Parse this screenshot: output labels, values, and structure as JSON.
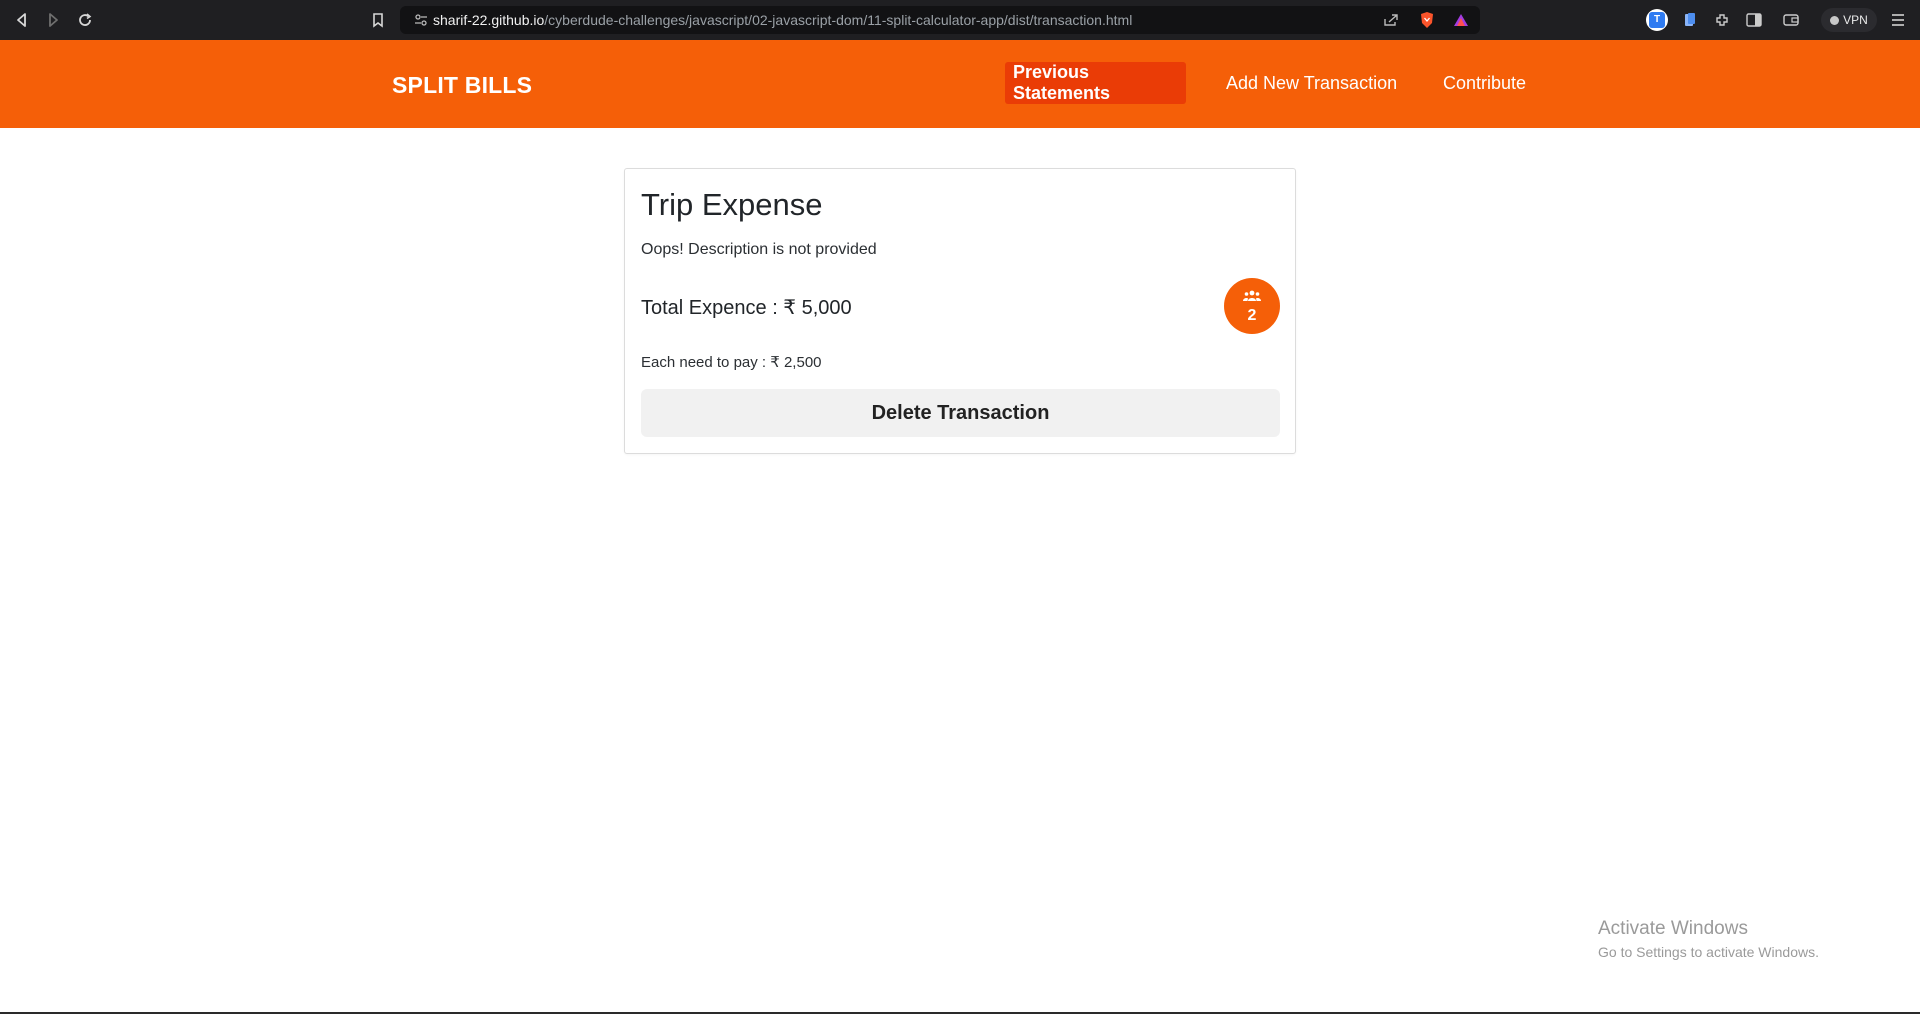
{
  "browser": {
    "url_host": "sharif-22.github.io",
    "url_path": "/cyberdude-challenges/javascript/02-javascript-dom/11-split-calculator-app/dist/transaction.html",
    "vpn_label": "VPN",
    "icons": [
      "back-icon",
      "forward-icon",
      "reload-icon",
      "bookmark-icon",
      "site-settings-icon",
      "share-icon",
      "brave-shield-icon",
      "brave-rewards-icon",
      "extension-icon",
      "sidebar-icon",
      "wallet-icon",
      "menu-icon"
    ]
  },
  "navbar": {
    "brand": "SPLIT BILLS",
    "links": [
      {
        "label": "Previous Statements",
        "active": true
      },
      {
        "label": "Add New Transaction",
        "active": false
      },
      {
        "label": "Contribute",
        "active": false
      }
    ],
    "accent_color": "#f55f08",
    "active_color": "#ea3c06"
  },
  "transaction": {
    "title": "Trip Expense",
    "description": "Oops! Description is not provided",
    "total_text": "Total Expence : ₹ 5,000",
    "people_count": "2",
    "each_text": "Each need to pay : ₹ 2,500",
    "delete_label": "Delete Transaction"
  },
  "watermark": {
    "title": "Activate Windows",
    "subtitle": "Go to Settings to activate Windows."
  }
}
